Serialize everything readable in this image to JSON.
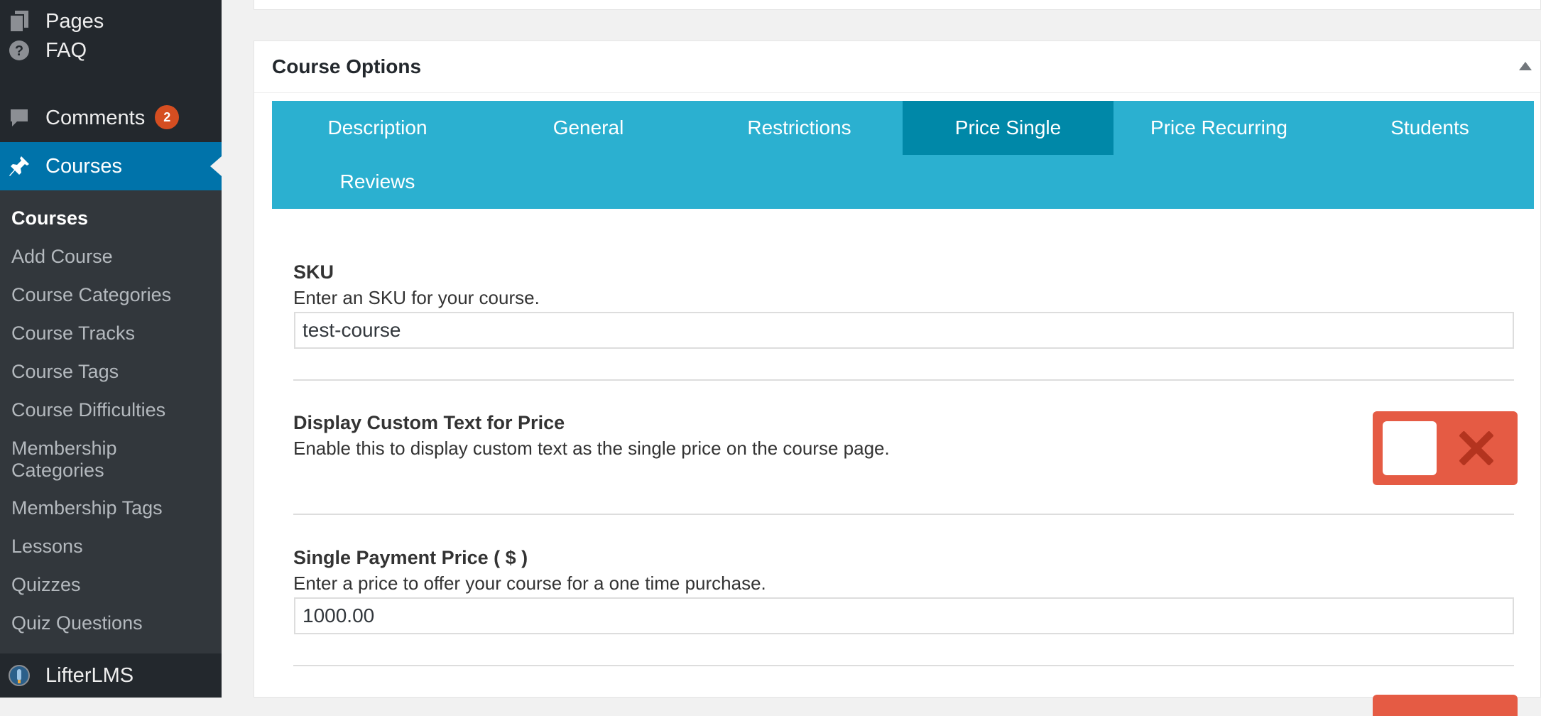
{
  "sidebar": {
    "top_items": [
      {
        "label": "Pages",
        "icon": "pages-icon"
      },
      {
        "label": "FAQ",
        "icon": "help-icon"
      },
      {
        "label": "Comments",
        "icon": "comments-icon",
        "badge": "2"
      },
      {
        "label": "Courses",
        "icon": "pin-icon",
        "current": true
      }
    ],
    "submenu": [
      {
        "label": "Courses",
        "current": true
      },
      {
        "label": "Add Course"
      },
      {
        "label": "Course Categories"
      },
      {
        "label": "Course Tracks"
      },
      {
        "label": "Course Tags"
      },
      {
        "label": "Course Difficulties"
      },
      {
        "label": "Membership\nCategories"
      },
      {
        "label": "Membership Tags"
      },
      {
        "label": "Lessons"
      },
      {
        "label": "Quizzes"
      },
      {
        "label": "Quiz Questions"
      }
    ],
    "bottom_item": {
      "label": "LifterLMS",
      "icon": "lifterlms-icon"
    }
  },
  "postbox": {
    "title": "Course Options",
    "tabs": [
      {
        "label": "Description"
      },
      {
        "label": "General"
      },
      {
        "label": "Restrictions"
      },
      {
        "label": "Price Single",
        "active": true
      },
      {
        "label": "Price Recurring"
      },
      {
        "label": "Students"
      },
      {
        "label": "Reviews"
      }
    ],
    "fields": {
      "sku": {
        "title": "SKU",
        "description": "Enter an SKU for your course.",
        "value": "test-course"
      },
      "custom_text": {
        "title": "Display Custom Text for Price",
        "description": "Enable this to display custom text as the single price on the course page.",
        "enabled": false
      },
      "single_price": {
        "title": "Single Payment Price ( $ )",
        "description": "Enter a price to offer your course for a one time purchase.",
        "value": "1000.00"
      }
    }
  },
  "colors": {
    "sidebar_bg": "#23282d",
    "submenu_bg": "#32373c",
    "current_menu": "#0073aa",
    "tabs_bg": "#2bb0d0",
    "tab_active": "#0088a8",
    "toggle_off": "#e55b44",
    "badge": "#d54e21"
  }
}
